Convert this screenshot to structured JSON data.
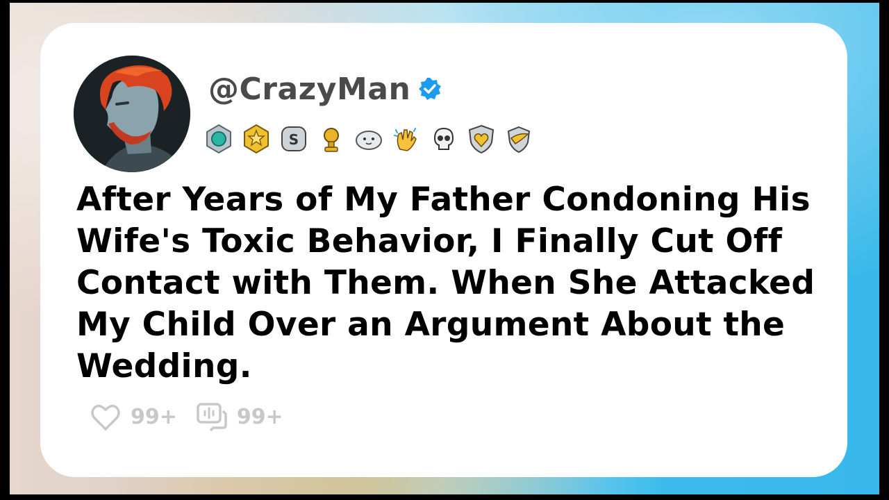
{
  "post": {
    "username": "@CrazyMan",
    "title": "After Years of My Father Condoning His Wife's Toxic Behavior, I Finally Cut Off Contact with Them. When She Attacked My Child Over an Argument About the Wedding.",
    "likes": "99+",
    "comments": "99+"
  },
  "badges": [
    {
      "icon": "hexagon-gem-badge-icon"
    },
    {
      "icon": "gold-star-badge-icon"
    },
    {
      "icon": "silver-s-badge-icon"
    },
    {
      "icon": "gold-trophy-badge-icon"
    },
    {
      "icon": "seal-face-badge-icon"
    },
    {
      "icon": "clapping-hands-badge-icon"
    },
    {
      "icon": "skull-badge-icon"
    },
    {
      "icon": "gold-heart-shield-badge-icon"
    },
    {
      "icon": "winged-shield-badge-icon"
    }
  ],
  "colors": {
    "card": "#ffffff",
    "title_text": "#000000",
    "username_text": "#4a4a4a",
    "verified": "#1d9bf0",
    "stat_gray": "#c8c8c8"
  }
}
